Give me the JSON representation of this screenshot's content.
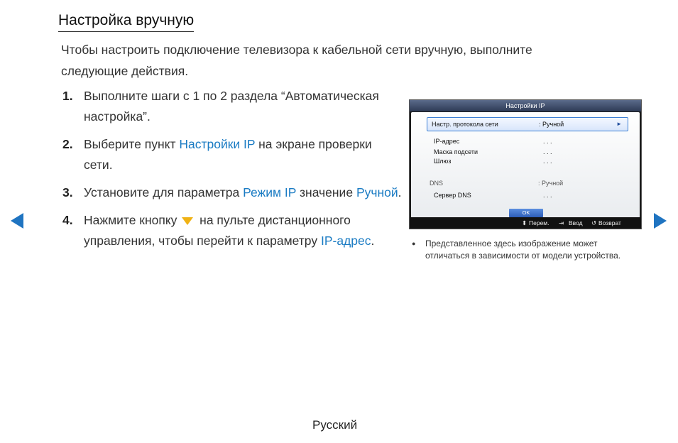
{
  "page": {
    "title": "Настройка вручную",
    "intro": "Чтобы настроить подключение телевизора к кабельной сети вручную, выполните следующие действия.",
    "footer": "Русский"
  },
  "steps": [
    {
      "num": "1.",
      "text_a": "Выполните шаги с 1 по 2 раздела “Автоматическая настройка”."
    },
    {
      "num": "2.",
      "text_a": "Выберите пункт ",
      "kw": "Настройки IP",
      "text_b": " на экране проверки сети."
    },
    {
      "num": "3.",
      "text_a": "Установите для параметра ",
      "kw": "Режим IP",
      "text_b": " значение ",
      "kw2": "Ручной",
      "text_c": "."
    },
    {
      "num": "4.",
      "text_a": "Нажмите кнопку ",
      "text_b": " на пульте дистанционного управления, чтобы перейти к параметру ",
      "kw": "IP-адрес",
      "text_c": "."
    }
  ],
  "screen": {
    "header": "Настройки IP",
    "protocol_label": "Настр. протокола сети",
    "protocol_value": ": Ручной",
    "rows": [
      {
        "label": "IP-адрес",
        "value": ". . ."
      },
      {
        "label": "Маска подсети",
        "value": ". . ."
      },
      {
        "label": "Шлюз",
        "value": ". . ."
      }
    ],
    "dns_label": "DNS",
    "dns_value": ": Ручной",
    "dns_server_label": "Сервер DNS",
    "dns_server_value": ". . .",
    "ok_label": "OK",
    "footer": {
      "move": "Перем.",
      "enter": "Ввод",
      "back": "Возврат"
    }
  },
  "note": "Представленное здесь изображение может отличаться в зависимости от модели устройства.",
  "icons": {
    "left_arrow": "nav-left-icon",
    "right_arrow": "nav-right-icon",
    "down_arrow": "down-triangle-icon"
  },
  "colors": {
    "accent": "#1a7bc3",
    "nav": "#1f74c1",
    "button": "#f0b214"
  }
}
